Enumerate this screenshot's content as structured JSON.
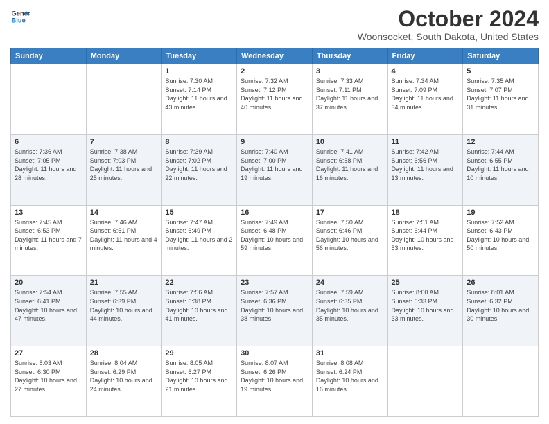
{
  "header": {
    "logo_line1": "General",
    "logo_line2": "Blue",
    "month_title": "October 2024",
    "location": "Woonsocket, South Dakota, United States"
  },
  "weekdays": [
    "Sunday",
    "Monday",
    "Tuesday",
    "Wednesday",
    "Thursday",
    "Friday",
    "Saturday"
  ],
  "weeks": [
    [
      null,
      null,
      {
        "day": 1,
        "sunrise": "7:30 AM",
        "sunset": "7:14 PM",
        "daylight": "11 hours and 43 minutes."
      },
      {
        "day": 2,
        "sunrise": "7:32 AM",
        "sunset": "7:12 PM",
        "daylight": "11 hours and 40 minutes."
      },
      {
        "day": 3,
        "sunrise": "7:33 AM",
        "sunset": "7:11 PM",
        "daylight": "11 hours and 37 minutes."
      },
      {
        "day": 4,
        "sunrise": "7:34 AM",
        "sunset": "7:09 PM",
        "daylight": "11 hours and 34 minutes."
      },
      {
        "day": 5,
        "sunrise": "7:35 AM",
        "sunset": "7:07 PM",
        "daylight": "11 hours and 31 minutes."
      }
    ],
    [
      {
        "day": 6,
        "sunrise": "7:36 AM",
        "sunset": "7:05 PM",
        "daylight": "11 hours and 28 minutes."
      },
      {
        "day": 7,
        "sunrise": "7:38 AM",
        "sunset": "7:03 PM",
        "daylight": "11 hours and 25 minutes."
      },
      {
        "day": 8,
        "sunrise": "7:39 AM",
        "sunset": "7:02 PM",
        "daylight": "11 hours and 22 minutes."
      },
      {
        "day": 9,
        "sunrise": "7:40 AM",
        "sunset": "7:00 PM",
        "daylight": "11 hours and 19 minutes."
      },
      {
        "day": 10,
        "sunrise": "7:41 AM",
        "sunset": "6:58 PM",
        "daylight": "11 hours and 16 minutes."
      },
      {
        "day": 11,
        "sunrise": "7:42 AM",
        "sunset": "6:56 PM",
        "daylight": "11 hours and 13 minutes."
      },
      {
        "day": 12,
        "sunrise": "7:44 AM",
        "sunset": "6:55 PM",
        "daylight": "11 hours and 10 minutes."
      }
    ],
    [
      {
        "day": 13,
        "sunrise": "7:45 AM",
        "sunset": "6:53 PM",
        "daylight": "11 hours and 7 minutes."
      },
      {
        "day": 14,
        "sunrise": "7:46 AM",
        "sunset": "6:51 PM",
        "daylight": "11 hours and 4 minutes."
      },
      {
        "day": 15,
        "sunrise": "7:47 AM",
        "sunset": "6:49 PM",
        "daylight": "11 hours and 2 minutes."
      },
      {
        "day": 16,
        "sunrise": "7:49 AM",
        "sunset": "6:48 PM",
        "daylight": "10 hours and 59 minutes."
      },
      {
        "day": 17,
        "sunrise": "7:50 AM",
        "sunset": "6:46 PM",
        "daylight": "10 hours and 56 minutes."
      },
      {
        "day": 18,
        "sunrise": "7:51 AM",
        "sunset": "6:44 PM",
        "daylight": "10 hours and 53 minutes."
      },
      {
        "day": 19,
        "sunrise": "7:52 AM",
        "sunset": "6:43 PM",
        "daylight": "10 hours and 50 minutes."
      }
    ],
    [
      {
        "day": 20,
        "sunrise": "7:54 AM",
        "sunset": "6:41 PM",
        "daylight": "10 hours and 47 minutes."
      },
      {
        "day": 21,
        "sunrise": "7:55 AM",
        "sunset": "6:39 PM",
        "daylight": "10 hours and 44 minutes."
      },
      {
        "day": 22,
        "sunrise": "7:56 AM",
        "sunset": "6:38 PM",
        "daylight": "10 hours and 41 minutes."
      },
      {
        "day": 23,
        "sunrise": "7:57 AM",
        "sunset": "6:36 PM",
        "daylight": "10 hours and 38 minutes."
      },
      {
        "day": 24,
        "sunrise": "7:59 AM",
        "sunset": "6:35 PM",
        "daylight": "10 hours and 35 minutes."
      },
      {
        "day": 25,
        "sunrise": "8:00 AM",
        "sunset": "6:33 PM",
        "daylight": "10 hours and 33 minutes."
      },
      {
        "day": 26,
        "sunrise": "8:01 AM",
        "sunset": "6:32 PM",
        "daylight": "10 hours and 30 minutes."
      }
    ],
    [
      {
        "day": 27,
        "sunrise": "8:03 AM",
        "sunset": "6:30 PM",
        "daylight": "10 hours and 27 minutes."
      },
      {
        "day": 28,
        "sunrise": "8:04 AM",
        "sunset": "6:29 PM",
        "daylight": "10 hours and 24 minutes."
      },
      {
        "day": 29,
        "sunrise": "8:05 AM",
        "sunset": "6:27 PM",
        "daylight": "10 hours and 21 minutes."
      },
      {
        "day": 30,
        "sunrise": "8:07 AM",
        "sunset": "6:26 PM",
        "daylight": "10 hours and 19 minutes."
      },
      {
        "day": 31,
        "sunrise": "8:08 AM",
        "sunset": "6:24 PM",
        "daylight": "10 hours and 16 minutes."
      },
      null,
      null
    ]
  ],
  "labels": {
    "sunrise": "Sunrise:",
    "sunset": "Sunset:",
    "daylight": "Daylight:"
  }
}
